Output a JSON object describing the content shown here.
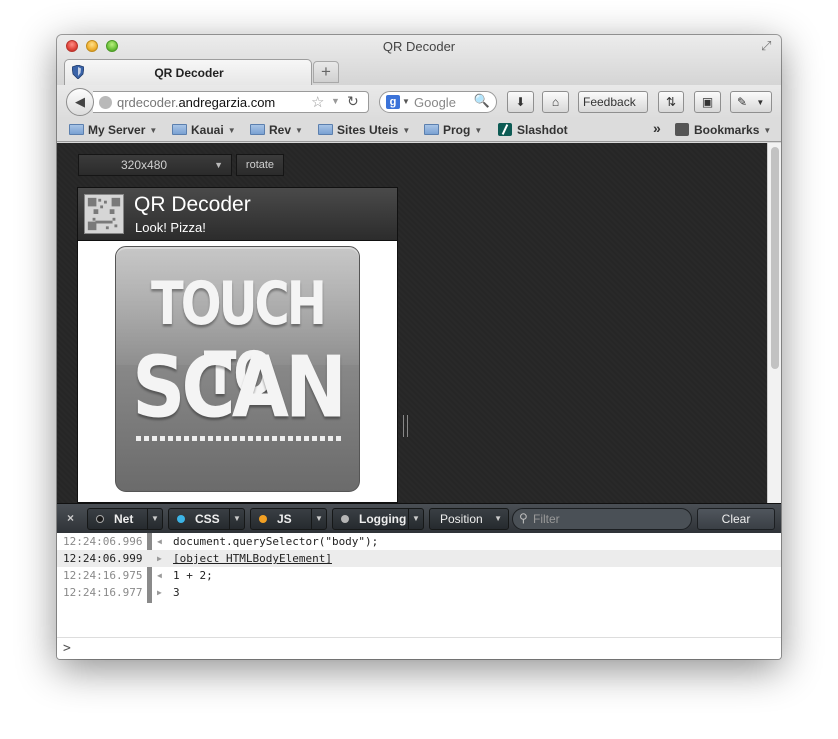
{
  "window": {
    "title": "QR Decoder"
  },
  "tab": {
    "title": "QR Decoder"
  },
  "newtab_label": "+",
  "navbar": {
    "url_domain_prefix": "qrdecoder.",
    "url_domain_main": "andregarzia.com",
    "search_engine_letter": "g",
    "search_placeholder": "Google",
    "feedback_label": "Feedback"
  },
  "bookmarks": [
    {
      "label": "My Server",
      "icon": "folder-icon"
    },
    {
      "label": "Kauai",
      "icon": "folder-icon"
    },
    {
      "label": "Rev",
      "icon": "folder-icon"
    },
    {
      "label": "Sites Uteis",
      "icon": "folder-icon"
    },
    {
      "label": "Prog",
      "icon": "folder-icon"
    },
    {
      "label": "Slashdot",
      "icon": "slashdot-icon"
    }
  ],
  "bookmarks_overflow": "»",
  "bookmarks_menu_label": "Bookmarks",
  "emulator": {
    "size_value": "320x480",
    "rotate_label": "rotate"
  },
  "app": {
    "title": "QR Decoder",
    "subtitle": "Look! Pizza!",
    "scan_line1": "TOUCH TO",
    "scan_line2": "SCAN"
  },
  "console": {
    "close_label": "×",
    "filters": [
      {
        "label": "Net",
        "color": "#1a1a1a"
      },
      {
        "label": "CSS",
        "color": "#3cb4e6"
      },
      {
        "label": "JS",
        "color": "#f2a023"
      },
      {
        "label": "Logging",
        "color": "#b5b5b5"
      }
    ],
    "position_label": "Position",
    "filter_placeholder": "Filter",
    "clear_label": "Clear",
    "rows": [
      {
        "time": "12:24:06.996",
        "dir": "◀",
        "text": "document.querySelector(\"body\");"
      },
      {
        "time": "12:24:06.999",
        "dir": "▶",
        "text": "[object HTMLBodyElement]"
      },
      {
        "time": "12:24:16.975",
        "dir": "◀",
        "text": "1 + 2;"
      },
      {
        "time": "12:24:16.977",
        "dir": "▶",
        "text": "3"
      }
    ],
    "prompt": ">"
  }
}
